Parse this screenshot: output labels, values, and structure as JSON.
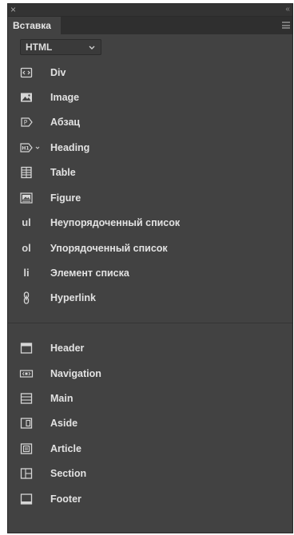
{
  "panel": {
    "close_glyph": "×",
    "collapse_glyph": "‹‹",
    "tab_label": "Вставка"
  },
  "category_select": {
    "value": "HTML"
  },
  "basic_items": [
    {
      "label": "Div",
      "icon": "div-tag-icon"
    },
    {
      "label": "Image",
      "icon": "image-icon"
    },
    {
      "label": "Абзац",
      "icon": "paragraph-icon"
    },
    {
      "label": "Heading",
      "icon": "heading-icon"
    },
    {
      "label": "Table",
      "icon": "table-icon"
    },
    {
      "label": "Figure",
      "icon": "figure-icon"
    },
    {
      "label": "Неупорядоченный список",
      "icon": "unordered-list-icon",
      "glyph": "ul"
    },
    {
      "label": "Упорядоченный список",
      "icon": "ordered-list-icon",
      "glyph": "ol"
    },
    {
      "label": "Элемент списка",
      "icon": "list-item-icon",
      "glyph": "li"
    },
    {
      "label": "Hyperlink",
      "icon": "hyperlink-icon"
    }
  ],
  "structure_items": [
    {
      "label": "Header",
      "icon": "header-icon"
    },
    {
      "label": "Navigation",
      "icon": "navigation-icon"
    },
    {
      "label": "Main",
      "icon": "main-icon"
    },
    {
      "label": "Aside",
      "icon": "aside-icon"
    },
    {
      "label": "Article",
      "icon": "article-icon"
    },
    {
      "label": "Section",
      "icon": "section-icon"
    },
    {
      "label": "Footer",
      "icon": "footer-icon"
    }
  ]
}
